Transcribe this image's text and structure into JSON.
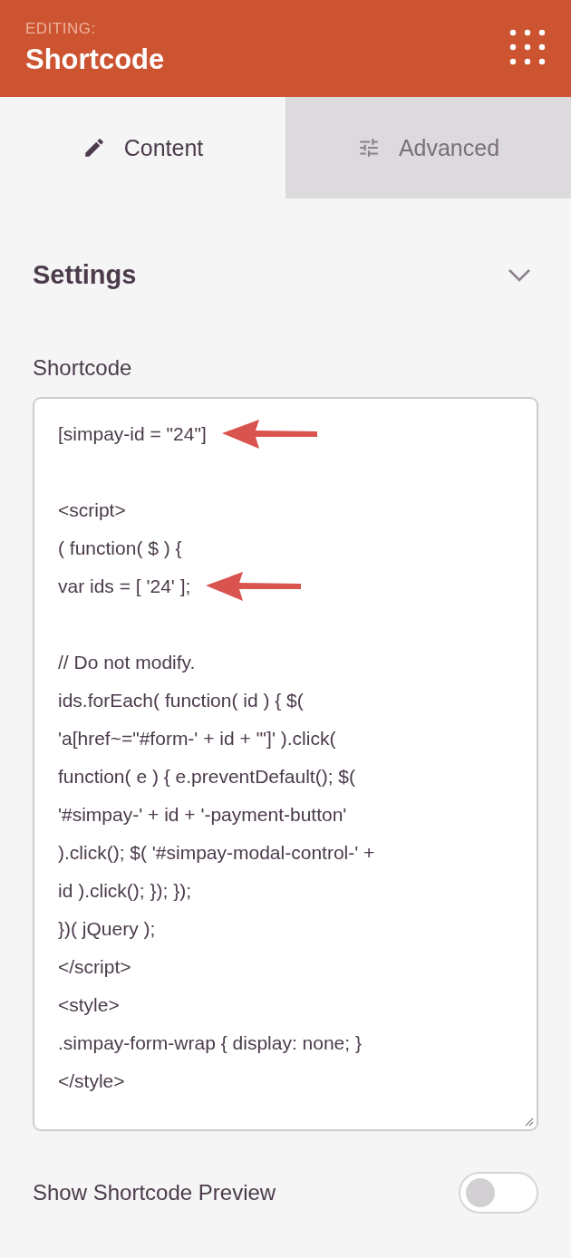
{
  "header": {
    "overline": "EDITING:",
    "title": "Shortcode"
  },
  "tabs": [
    {
      "label": "Content",
      "kind": "pencil",
      "selected": true
    },
    {
      "label": "Advanced",
      "kind": "sliders",
      "selected": false
    }
  ],
  "section": {
    "title": "Settings",
    "expanded": true
  },
  "field": {
    "label": "Shortcode",
    "blocks": [
      [
        {
          "text": "[simpay-id = \"24\"]",
          "arrow": true
        }
      ],
      [
        {
          "text": "<script>",
          "arrow": false
        },
        {
          "text": "( function( $ ) {",
          "arrow": false
        },
        {
          "text": "var ids = [ '24' ];",
          "arrow": true
        }
      ],
      [
        {
          "text": "// Do not modify.",
          "arrow": false
        },
        {
          "text": "ids.forEach( function( id ) { $(",
          "arrow": false
        },
        {
          "text": "'a[href~=\"#form-' + id + '\"]' ).click(",
          "arrow": false
        },
        {
          "text": "function( e ) { e.preventDefault(); $(",
          "arrow": false
        },
        {
          "text": "'#simpay-' + id + '-payment-button'",
          "arrow": false
        },
        {
          "text": ").click(); $( '#simpay-modal-control-' +",
          "arrow": false
        },
        {
          "text": "id ).click(); }); });",
          "arrow": false
        },
        {
          "text": "})( jQuery );",
          "arrow": false
        },
        {
          "text": "</script>",
          "arrow": false
        },
        {
          "text": "<style>",
          "arrow": false
        },
        {
          "text": ".simpay-form-wrap { display: none; }",
          "arrow": false
        },
        {
          "text": "</style>",
          "arrow": false
        }
      ]
    ]
  },
  "preview_toggle": {
    "label": "Show Shortcode Preview",
    "on": false
  }
}
